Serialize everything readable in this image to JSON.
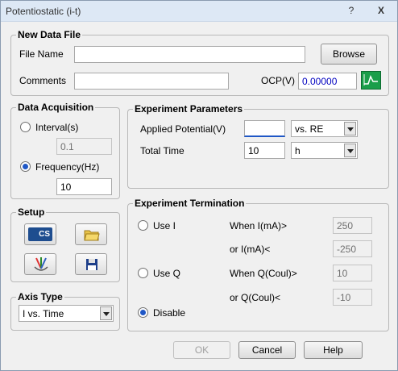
{
  "window": {
    "title": "Potentiostatic (i-t)",
    "help_btn": "?",
    "close_btn": "X"
  },
  "new_data_file": {
    "legend": "New Data File",
    "file_name_label": "File Name",
    "file_name_value": "",
    "browse_label": "Browse",
    "comments_label": "Comments",
    "comments_value": "",
    "ocp_label": "OCP(V)",
    "ocp_value": "0.00000"
  },
  "data_acquisition": {
    "legend": "Data Acquisition",
    "interval_label": "Interval(s)",
    "interval_value": "0.1",
    "frequency_label": "Frequency(Hz)",
    "frequency_value": "10",
    "selected": "frequency"
  },
  "setup": {
    "legend": "Setup",
    "cs_label": "CS"
  },
  "axis_type": {
    "legend": "Axis Type",
    "value": "I vs. Time"
  },
  "experiment_parameters": {
    "legend": "Experiment Parameters",
    "applied_potential_label": "Applied Potential(V)",
    "applied_potential_value": "",
    "reference": "vs. RE",
    "total_time_label": "Total Time",
    "total_time_value": "10",
    "time_unit": "h"
  },
  "experiment_termination": {
    "legend": "Experiment Termination",
    "use_i_label": "Use I",
    "when_i_label": "When I(mA)>",
    "when_i_value": "250",
    "or_i_label": "or I(mA)<",
    "or_i_value": "-250",
    "use_q_label": "Use Q",
    "when_q_label": "When Q(Coul)>",
    "when_q_value": "10",
    "or_q_label": "or Q(Coul)<",
    "or_q_value": "-10",
    "disable_label": "Disable",
    "selected": "disable"
  },
  "buttons": {
    "ok": "OK",
    "cancel": "Cancel",
    "help": "Help"
  },
  "colors": {
    "accent": "#1f57c6",
    "ocp_text": "#0000c0",
    "chart_icon": "#1a9e4a"
  }
}
